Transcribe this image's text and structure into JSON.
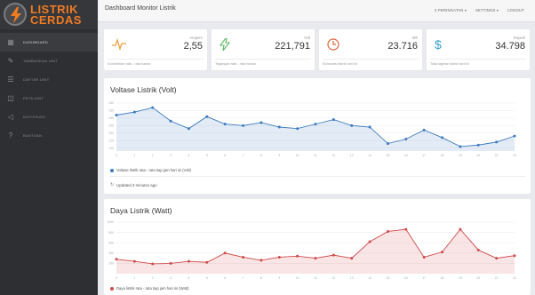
{
  "brand": {
    "line1": "LISTRIK",
    "line2": "CERDAS",
    "accent": "#f07b23"
  },
  "sidebar": {
    "items": [
      {
        "label": "DASHBOARD",
        "icon": "dashboard-icon",
        "active": true
      },
      {
        "label": "TAMBAHKAN UNIT",
        "icon": "edit-icon",
        "active": false
      },
      {
        "label": "DAFTAR UNIT",
        "icon": "list-icon",
        "active": false
      },
      {
        "label": "PETA UNIT",
        "icon": "map-icon",
        "active": false
      },
      {
        "label": "NOTIFIKASI",
        "icon": "bell-icon",
        "active": false
      },
      {
        "label": "BANTUAN",
        "icon": "help-icon",
        "active": false
      }
    ]
  },
  "header": {
    "title": "Dashboard Monitor Listrik",
    "menu": {
      "notifications": "2 PERINGATAN ▾",
      "settings": "SETTINGS ▾",
      "logout": "LOGOUT"
    }
  },
  "stats": [
    {
      "icon": "pulse-icon",
      "color": "#f0a03c",
      "unit": "Ampere",
      "value": "2,55",
      "desc": "Arus/beban rata - rata harian"
    },
    {
      "icon": "bolt-icon",
      "color": "#5cb85c",
      "unit": "Volt",
      "value": "221,791",
      "desc": "Tegangan rata - rata harian"
    },
    {
      "icon": "clock-icon",
      "color": "#e0623a",
      "unit": "Wh",
      "value": "23.716",
      "desc": "Konsumsi listrik hari ini"
    },
    {
      "icon": "dollar-icon",
      "color": "#35a3c7",
      "unit": "Rupiah",
      "value": "34.798",
      "desc": "Total tagihan listrik hari ini"
    }
  ],
  "voltage_panel": {
    "title": "Voltase Listrik (Volt)",
    "legend": "Voltase listrik rata - rata tiap jam hari ini (Volt)",
    "updated": "Updated 3 minutes ago"
  },
  "power_panel": {
    "title": "Daya Listrik (Watt)",
    "legend": "Daya listrik rata - rata tiap jam hari ini (Watt)"
  },
  "chart_data": [
    {
      "type": "area",
      "title": "Voltase Listrik (Volt)",
      "x": [
        0,
        1,
        2,
        3,
        4,
        5,
        6,
        7,
        8,
        9,
        10,
        11,
        12,
        13,
        14,
        15,
        16,
        17,
        18,
        19,
        20,
        21,
        22
      ],
      "ylim": [
        208,
        240
      ],
      "yticks": [
        210,
        215,
        220,
        225,
        230,
        235,
        240
      ],
      "series": [
        {
          "name": "Voltase listrik rata - rata tiap jam hari ini (Volt)",
          "color": "#3c7bbf",
          "values": [
            232,
            234,
            237,
            228,
            223,
            231,
            226,
            225,
            227,
            224,
            223,
            226,
            229,
            225,
            224,
            213,
            216,
            222,
            217,
            211,
            212,
            214,
            218
          ]
        }
      ],
      "grid": true,
      "legend": "bottom-left"
    },
    {
      "type": "area",
      "title": "Daya Listrik (Watt)",
      "x": [
        0,
        1,
        2,
        3,
        4,
        5,
        6,
        7,
        8,
        9,
        10,
        11,
        12,
        13,
        14,
        15,
        16,
        17,
        18,
        19,
        20,
        21,
        22
      ],
      "ylim": [
        0,
        1000
      ],
      "yticks": [
        200,
        400,
        600,
        800,
        1000
      ],
      "series": [
        {
          "name": "Daya listrik rata - rata tiap jam hari ini (Watt)",
          "color": "#d14a4a",
          "values": [
            280,
            240,
            190,
            200,
            240,
            220,
            400,
            320,
            260,
            320,
            340,
            300,
            360,
            300,
            620,
            820,
            860,
            320,
            420,
            860,
            460,
            300,
            350
          ]
        }
      ],
      "grid": true,
      "legend": "bottom-left"
    }
  ]
}
